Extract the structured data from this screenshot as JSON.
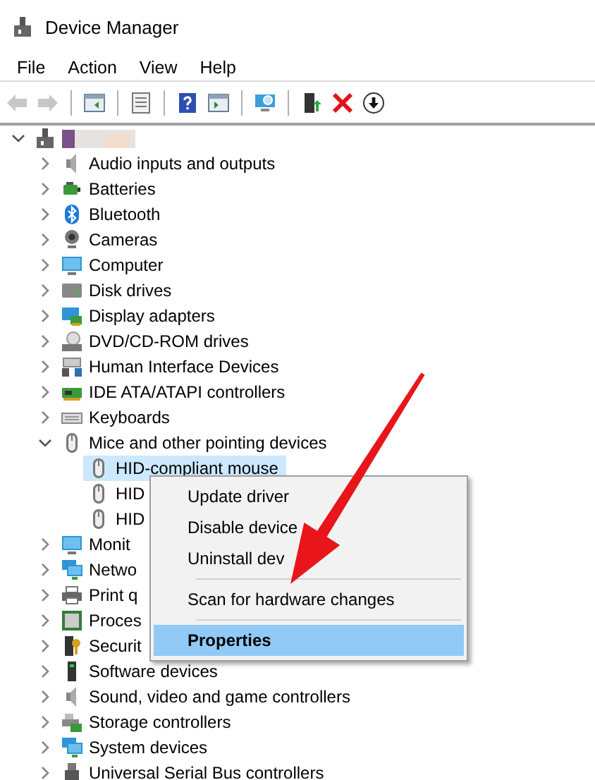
{
  "window": {
    "title": "Device Manager"
  },
  "menu": [
    "File",
    "Action",
    "View",
    "Help"
  ],
  "toolbar": [
    {
      "kind": "back",
      "disabled": true
    },
    {
      "kind": "forward",
      "disabled": true
    },
    {
      "kind": "separator"
    },
    {
      "kind": "pane",
      "disabled": false
    },
    {
      "kind": "separator"
    },
    {
      "kind": "properties",
      "disabled": false
    },
    {
      "kind": "separator"
    },
    {
      "kind": "help",
      "disabled": false
    },
    {
      "kind": "action-pane",
      "disabled": false
    },
    {
      "kind": "separator"
    },
    {
      "kind": "scan",
      "disabled": false
    },
    {
      "kind": "separator"
    },
    {
      "kind": "update",
      "disabled": false
    },
    {
      "kind": "uninstall",
      "disabled": false
    },
    {
      "kind": "download",
      "disabled": false
    }
  ],
  "tree": {
    "expanded": true,
    "children": [
      {
        "kind": "audio",
        "label": "Audio inputs and outputs",
        "expanded": false
      },
      {
        "kind": "battery",
        "label": "Batteries",
        "expanded": false
      },
      {
        "kind": "bluetooth",
        "label": "Bluetooth",
        "expanded": false
      },
      {
        "kind": "camera",
        "label": "Cameras",
        "expanded": false
      },
      {
        "kind": "computer",
        "label": "Computer",
        "expanded": false
      },
      {
        "kind": "disk",
        "label": "Disk drives",
        "expanded": false
      },
      {
        "kind": "display",
        "label": "Display adapters",
        "expanded": false
      },
      {
        "kind": "dvd",
        "label": "DVD/CD-ROM drives",
        "expanded": false
      },
      {
        "kind": "hid",
        "label": "Human Interface Devices",
        "expanded": false
      },
      {
        "kind": "card",
        "label": "IDE ATA/ATAPI controllers",
        "expanded": false
      },
      {
        "kind": "keyboard",
        "label": "Keyboards",
        "expanded": false
      },
      {
        "kind": "mouse",
        "label": "Mice and other pointing devices",
        "expanded": true,
        "children": [
          {
            "kind": "mouse",
            "label": "HID-compliant mouse",
            "selected": true
          },
          {
            "kind": "mouse",
            "label": "HID",
            "selected": false
          },
          {
            "kind": "mouse",
            "label": "HID",
            "selected": false
          }
        ]
      },
      {
        "kind": "computer",
        "label": "Monit",
        "expanded": false
      },
      {
        "kind": "network",
        "label": "Netwo",
        "expanded": false
      },
      {
        "kind": "printer",
        "label": "Print q",
        "expanded": false
      },
      {
        "kind": "processor",
        "label": "Proces",
        "expanded": false
      },
      {
        "kind": "security",
        "label": "Securit",
        "expanded": false
      },
      {
        "kind": "software",
        "label": "Software devices",
        "expanded": false
      },
      {
        "kind": "audio",
        "label": "Sound, video and game controllers",
        "expanded": false
      },
      {
        "kind": "storage",
        "label": "Storage controllers",
        "expanded": false
      },
      {
        "kind": "network",
        "label": "System devices",
        "expanded": false
      },
      {
        "kind": "usb",
        "label": "Universal Serial Bus controllers",
        "expanded": false
      }
    ]
  },
  "context_menu": {
    "items": [
      {
        "kind": "item",
        "label": "Update driver",
        "selected": false
      },
      {
        "kind": "item",
        "label": "Disable device",
        "selected": false
      },
      {
        "kind": "item",
        "label": "Uninstall dev",
        "selected": false
      },
      {
        "kind": "separator"
      },
      {
        "kind": "item",
        "label": "Scan for hardware changes",
        "selected": false
      },
      {
        "kind": "separator"
      },
      {
        "kind": "item",
        "label": "Properties",
        "selected": true
      }
    ]
  }
}
